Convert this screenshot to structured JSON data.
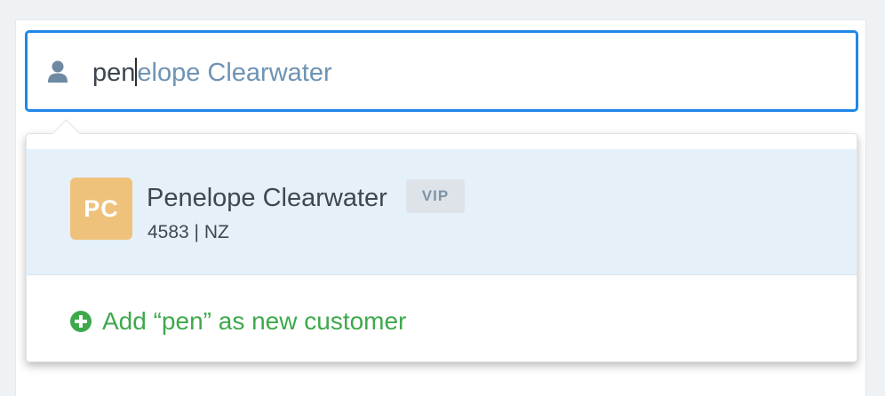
{
  "search": {
    "icon": "user-icon",
    "typed_text": "pen",
    "suggestion_completion": "elope Clearwater",
    "focus_color": "#1f87e8"
  },
  "results": [
    {
      "avatar_initials": "PC",
      "avatar_color": "#efc27c",
      "name": "Penelope Clearwater",
      "badge": "VIP",
      "meta": "4583 | NZ",
      "highlighted": true
    }
  ],
  "add_customer": {
    "icon": "plus-circle-icon",
    "label": "Add “pen” as new customer",
    "color": "#3ea94b"
  }
}
